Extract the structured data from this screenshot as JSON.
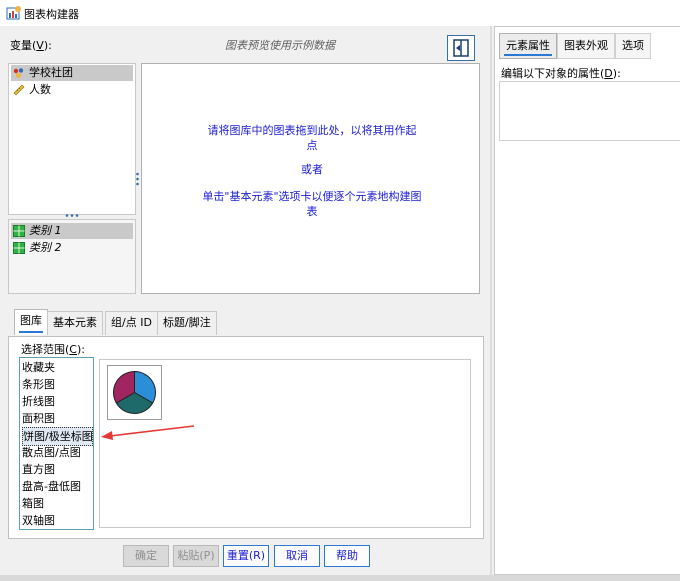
{
  "window": {
    "title": "图表构建器"
  },
  "variables": {
    "label_prefix": "变量(",
    "label_key": "V",
    "label_suffix": "):",
    "items": [
      {
        "name": "学校社团",
        "icon": "nominal-var-icon",
        "selected": true
      },
      {
        "name": "人数",
        "icon": "ruler-scale-icon",
        "selected": false
      }
    ],
    "categories": [
      {
        "name": "类别 1",
        "selected": true
      },
      {
        "name": "类别 2",
        "selected": false
      }
    ]
  },
  "preview": {
    "note": "图表预览使用示例数据",
    "msg1_line1": "请将图库中的图表拖到此处，以将其用作起",
    "msg1_line2": "点",
    "msg_or": "或者",
    "msg2_line1": "单击\"基本元素\"选项卡以便逐个元素地构建图",
    "msg2_line2": "表"
  },
  "bottom_tabs": [
    {
      "label": "图库",
      "active": true
    },
    {
      "label": "基本元素",
      "active": false
    },
    {
      "label": "组/点 ID",
      "active": false
    },
    {
      "label": "标题/脚注",
      "active": false
    }
  ],
  "gallery": {
    "choose_prefix": "选择范围(",
    "choose_key": "C",
    "choose_suffix": "):",
    "chart_types": [
      "收藏夹",
      "条形图",
      "折线图",
      "面积图",
      "饼图/极坐标图",
      "散点图/点图",
      "直方图",
      "盘高-盘低图",
      "箱图",
      "双轴图"
    ],
    "selected_index": 4,
    "pie_colors": [
      "#2b8fd8",
      "#1e6a6a",
      "#a1255f"
    ]
  },
  "buttons": {
    "ok": "确定",
    "paste": "粘贴(P)",
    "reset": "重置(R)",
    "cancel": "取消",
    "help": "帮助"
  },
  "right_panel": {
    "tabs": [
      {
        "label": "元素属性",
        "active": true
      },
      {
        "label": "图表外观",
        "active": false
      },
      {
        "label": "选项",
        "active": false
      }
    ],
    "edit_prefix": "编辑以下对象的属性(",
    "edit_key": "D",
    "edit_suffix": "):"
  },
  "annotation": {
    "arrow_color": "#e53935"
  }
}
